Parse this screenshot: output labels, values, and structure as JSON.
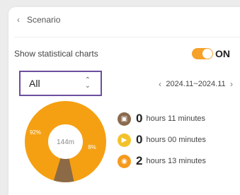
{
  "header": {
    "title": "Scenario"
  },
  "stats": {
    "label": "Show statistical charts",
    "toggle_state": "ON"
  },
  "filter": {
    "selected": "All"
  },
  "date_range": {
    "text": "2024.11~2024.11"
  },
  "chart_data": {
    "type": "pie",
    "center_label": "144m",
    "slices": [
      {
        "label": "92%",
        "value": 92,
        "color": "#f5a012"
      },
      {
        "label": "8%",
        "value": 8,
        "color": "#8c6a45"
      }
    ]
  },
  "legend": [
    {
      "icon": "screen-icon",
      "color": "#8b6a4e",
      "number": "0",
      "text": "hours 11 minutes"
    },
    {
      "icon": "play-icon",
      "color": "#f3c22a",
      "number": "0",
      "text": "hours 00 minutes"
    },
    {
      "icon": "app-icon",
      "color": "#f59a1d",
      "number": "2",
      "text": "hours 13 minutes"
    }
  ]
}
